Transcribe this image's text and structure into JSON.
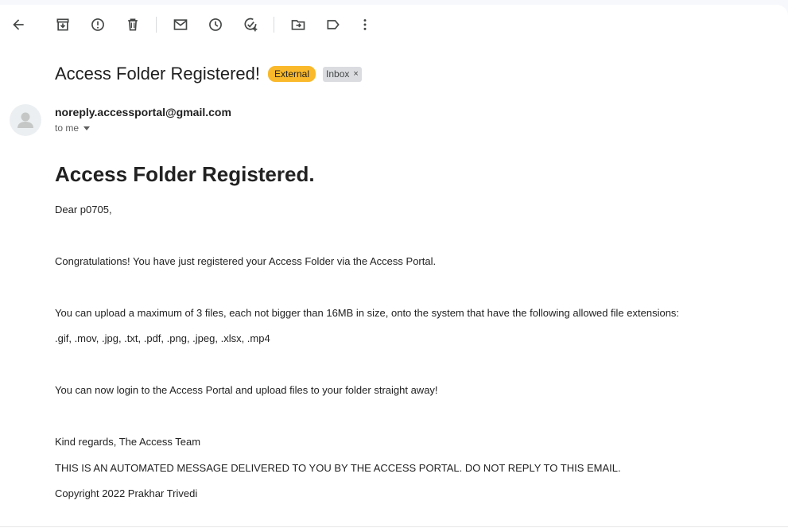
{
  "toolbar": {
    "icons": [
      "back-arrow-icon",
      "archive-icon",
      "report-spam-icon",
      "delete-icon",
      "mark-unread-icon",
      "snooze-icon",
      "add-to-tasks-icon",
      "move-to-icon",
      "label-icon",
      "more-icon"
    ]
  },
  "email": {
    "subject": "Access Folder Registered!",
    "external_label": "External",
    "inbox_label": "Inbox",
    "inbox_remove": "×",
    "sender": "noreply.accessportal@gmail.com",
    "recipient": "to me",
    "heading": "Access Folder Registered.",
    "greeting": "Dear p0705,",
    "para1": "Congratulations! You have just registered your Access Folder via the Access Portal.",
    "para2": "You can upload a maximum of 3 files, each not bigger than 16MB in size, onto the system that have the following allowed file extensions:",
    "extensions": ".gif, .mov, .jpg, .txt, .pdf, .png, .jpeg, .xlsx, .mp4",
    "para3": "You can now login to the Access Portal and upload files to your folder straight away!",
    "signoff": "Kind regards, The Access Team",
    "notice": "THIS IS AN AUTOMATED MESSAGE DELIVERED TO YOU BY THE ACCESS PORTAL. DO NOT REPLY TO THIS EMAIL.",
    "copyright": "Copyright 2022 Prakhar Trivedi"
  },
  "colors": {
    "external_chip": "#f9b92b",
    "inbox_chip": "#dadce0",
    "background": "#f6f8fc"
  }
}
